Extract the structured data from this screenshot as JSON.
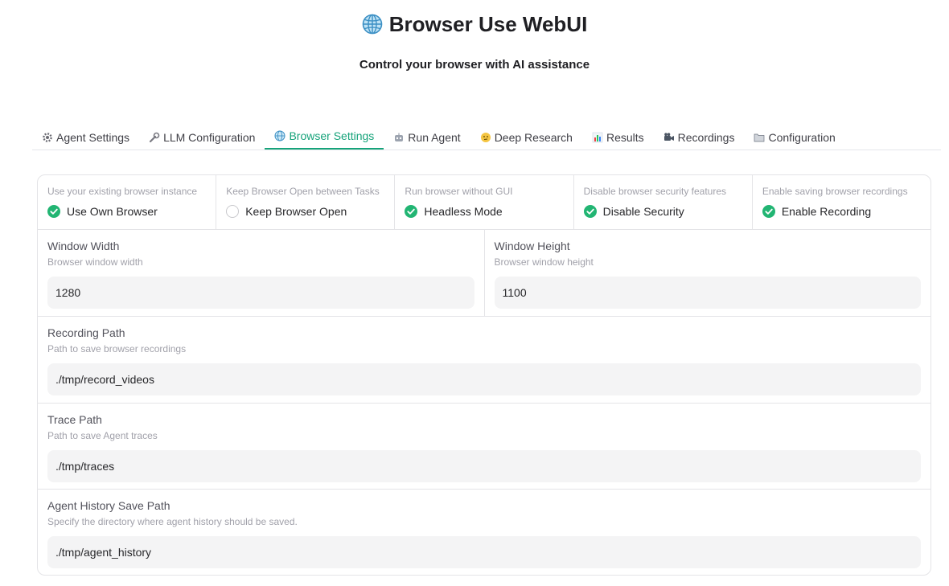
{
  "header": {
    "title": "Browser Use WebUI",
    "subtitle": "Control your browser with AI assistance",
    "icon": "globe-icon"
  },
  "tabs": [
    {
      "label": "Agent Settings",
      "icon": "gear-icon",
      "active": false
    },
    {
      "label": "LLM Configuration",
      "icon": "wrench-icon",
      "active": false
    },
    {
      "label": "Browser Settings",
      "icon": "globe-icon",
      "active": true
    },
    {
      "label": "Run Agent",
      "icon": "robot-icon",
      "active": false
    },
    {
      "label": "Deep Research",
      "icon": "thinking-face-icon",
      "active": false
    },
    {
      "label": "Results",
      "icon": "bar-chart-icon",
      "active": false
    },
    {
      "label": "Recordings",
      "icon": "video-camera-icon",
      "active": false
    },
    {
      "label": "Configuration",
      "icon": "folder-icon",
      "active": false
    }
  ],
  "checkboxes": [
    {
      "info": "Use your existing browser instance",
      "label": "Use Own Browser",
      "checked": true
    },
    {
      "info": "Keep Browser Open between Tasks",
      "label": "Keep Browser Open",
      "checked": false
    },
    {
      "info": "Run browser without GUI",
      "label": "Headless Mode",
      "checked": true
    },
    {
      "info": "Disable browser security features",
      "label": "Disable Security",
      "checked": true
    },
    {
      "info": "Enable saving browser recordings",
      "label": "Enable Recording",
      "checked": true
    }
  ],
  "fields": {
    "window_width": {
      "label": "Window Width",
      "info": "Browser window width",
      "value": "1280"
    },
    "window_height": {
      "label": "Window Height",
      "info": "Browser window height",
      "value": "1100"
    },
    "recording_path": {
      "label": "Recording Path",
      "info": "Path to save browser recordings",
      "value": "./tmp/record_videos"
    },
    "trace_path": {
      "label": "Trace Path",
      "info": "Path to save Agent traces",
      "value": "./tmp/traces"
    },
    "agent_history_path": {
      "label": "Agent History Save Path",
      "info": "Specify the directory where agent history should be saved.",
      "value": "./tmp/agent_history"
    }
  },
  "colors": {
    "accent": "#16a37a",
    "check": "#22b573"
  }
}
